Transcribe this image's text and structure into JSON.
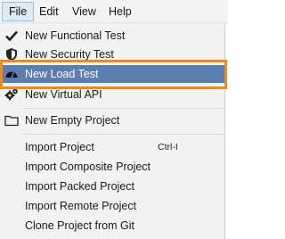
{
  "menubar": {
    "items": [
      {
        "label": "File",
        "active": true
      },
      {
        "label": "Edit"
      },
      {
        "label": "View"
      },
      {
        "label": "Help"
      }
    ]
  },
  "file_menu": {
    "items": [
      {
        "label": "New Functional Test",
        "icon": "checkmark-icon"
      },
      {
        "label": "New Security Test",
        "icon": "shield-icon"
      },
      {
        "label": "New Load Test",
        "icon": "gauge-icon",
        "selected": true
      },
      {
        "label": "New Virtual API",
        "icon": "gears-icon"
      },
      {
        "label": "New Empty Project",
        "icon": "folder-icon"
      },
      {
        "label": "Import Project",
        "shortcut": "Ctrl-I"
      },
      {
        "label": "Import Composite Project"
      },
      {
        "label": "Import Packed Project"
      },
      {
        "label": "Import Remote Project"
      },
      {
        "label": "Clone Project from Git"
      }
    ]
  },
  "colors": {
    "selection": "#5c7db0",
    "highlight_frame": "#f08a1c"
  }
}
